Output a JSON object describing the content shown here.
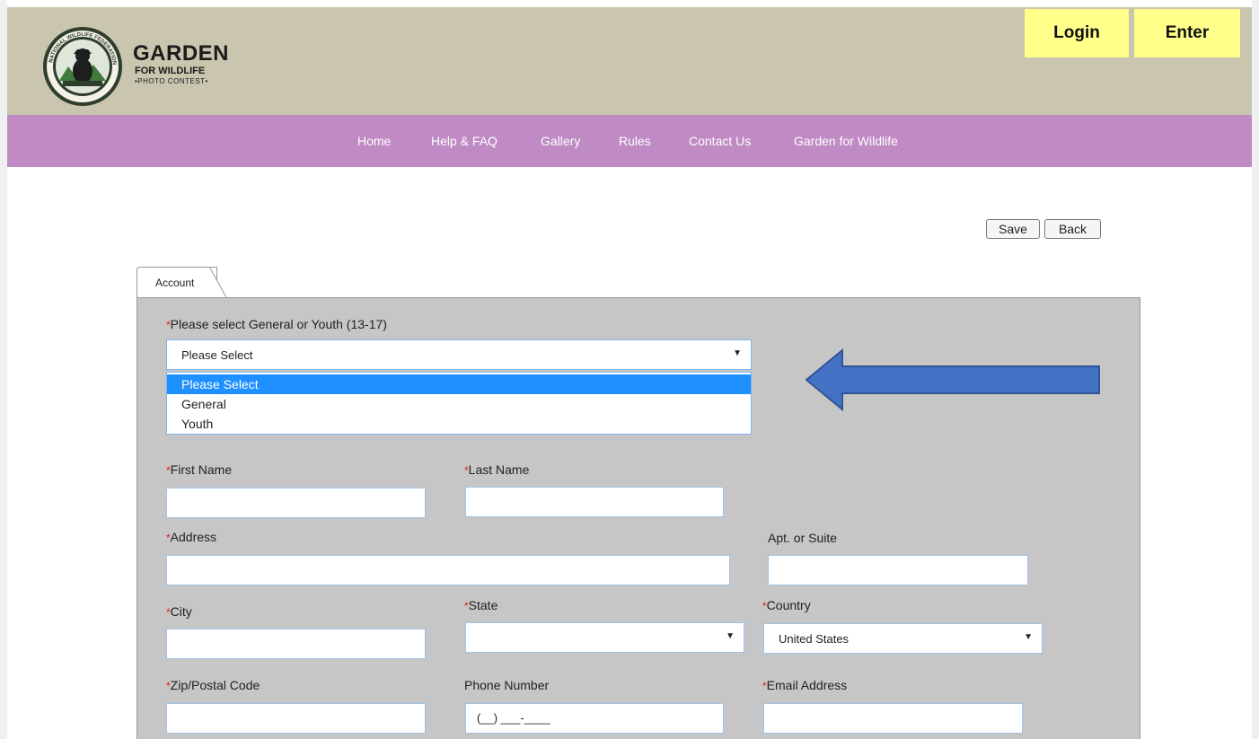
{
  "header": {
    "logo": {
      "seal_text": "NATIONAL WILDLIFE FEDERATION",
      "title": "GARDEN",
      "subtitle": "FOR WILDLIFE",
      "contest": "•PHOTO CONTEST•"
    },
    "login_label": "Login",
    "enter_label": "Enter"
  },
  "nav": {
    "items": [
      {
        "label": "Home"
      },
      {
        "label": "Help & FAQ"
      },
      {
        "label": "Gallery"
      },
      {
        "label": "Rules"
      },
      {
        "label": "Contact Us"
      },
      {
        "label": "Garden for Wildlife"
      }
    ]
  },
  "actions": {
    "save_label": "Save",
    "back_label": "Back"
  },
  "tabs": {
    "account_label": "Account"
  },
  "form": {
    "required_marker": "*",
    "category": {
      "label": "Please select General or Youth (13-17)",
      "selected": "Please Select",
      "options": [
        "Please Select",
        "General",
        "Youth"
      ]
    },
    "first_name": {
      "label": "First Name",
      "value": ""
    },
    "last_name": {
      "label": "Last Name",
      "value": ""
    },
    "address": {
      "label": "Address",
      "value": ""
    },
    "apt": {
      "label": "Apt. or Suite",
      "value": ""
    },
    "city": {
      "label": "City",
      "value": ""
    },
    "state": {
      "label": "State",
      "selected": ""
    },
    "country": {
      "label": "Country",
      "selected": "United States"
    },
    "zip": {
      "label": "Zip/Postal Code",
      "value": ""
    },
    "phone": {
      "label": "Phone Number",
      "value": "(__) ___-____"
    },
    "email": {
      "label": "Email Address",
      "value": ""
    }
  },
  "colors": {
    "header_bg": "#c9c5ae",
    "nav_bg": "#c08ac5",
    "button_yellow": "#ffff8a",
    "form_bg": "#c6c6c6",
    "highlight": "#1e90ff",
    "annotation_arrow": "#4472c4",
    "required": "#e02020"
  }
}
